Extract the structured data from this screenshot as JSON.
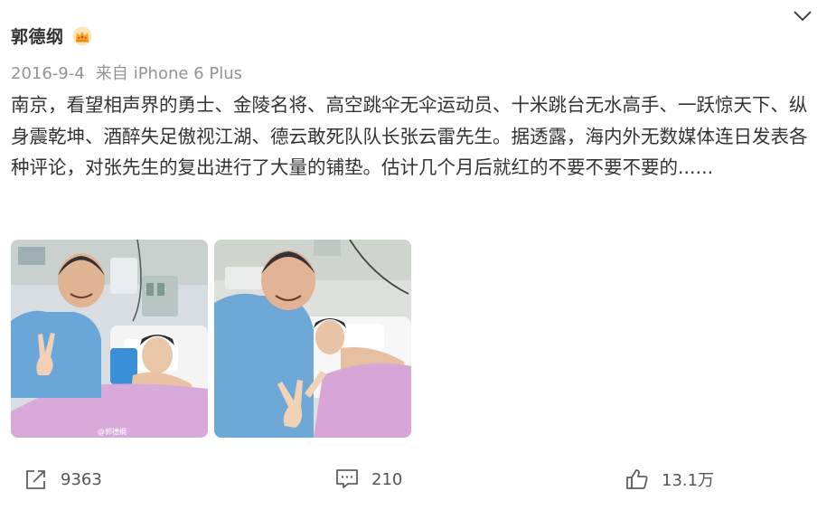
{
  "post": {
    "author": "郭德纲",
    "date": "2016-9-4",
    "source_prefix": "来自",
    "device": "iPhone 6 Plus",
    "text": "南京，看望相声界的勇士、金陵名将、高空跳伞无伞运动员、十米跳台无水高手、一跃惊天下、纵身震乾坤、酒醉失足傲视江湖、德云敢死队队长张云雷先生。据透露，海内外无数媒体连日发表各种评论，对张先生的复出进行了大量的铺垫。估计几个月后就红的不要不要不要的......",
    "images": [
      {
        "icon": "photo-hospital-1"
      },
      {
        "icon": "photo-hospital-2"
      }
    ],
    "watermark": "@郭德纲"
  },
  "actions": {
    "share_count": "9363",
    "comment_count": "210",
    "like_count": "13.1万"
  },
  "icons": {
    "expand": "chevron-down-icon",
    "badge": "crown-icon",
    "share": "share-icon",
    "comment": "comment-icon",
    "like": "thumbs-up-icon"
  },
  "colors": {
    "text": "#333333",
    "meta": "#939393",
    "icon": "#606060",
    "crown": "#f5a623"
  }
}
